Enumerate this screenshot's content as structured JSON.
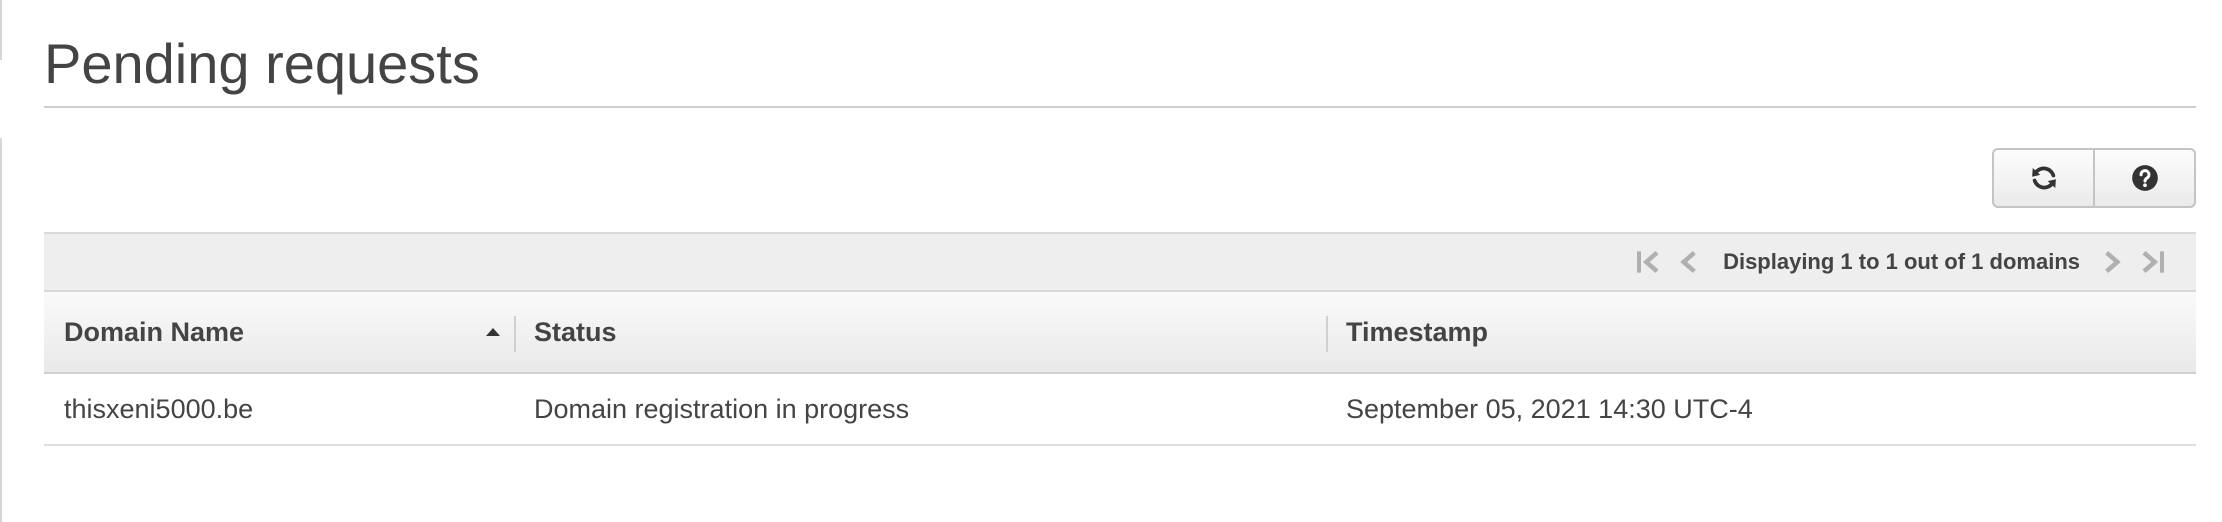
{
  "page": {
    "title": "Pending requests"
  },
  "toolbar": {
    "refresh_icon": "refresh-icon",
    "help_icon": "help-icon"
  },
  "pager": {
    "text": "Displaying 1 to 1 out of 1 domains",
    "icons": [
      "first-page-icon",
      "previous-page-icon",
      "next-page-icon",
      "last-page-icon"
    ]
  },
  "table": {
    "columns": [
      "Domain Name",
      "Status",
      "Timestamp"
    ],
    "sort": {
      "column": "Domain Name",
      "direction": "ascending"
    },
    "rows": [
      {
        "domain": "thisxeni5000.be",
        "status": "Domain registration in progress",
        "timestamp": "September 05, 2021 14:30 UTC-4"
      }
    ]
  },
  "colors": {
    "text": "#444444",
    "pager_background": "#eeeeee",
    "icon_disabled": "#b0b0b0",
    "icon_active": "#333333"
  }
}
